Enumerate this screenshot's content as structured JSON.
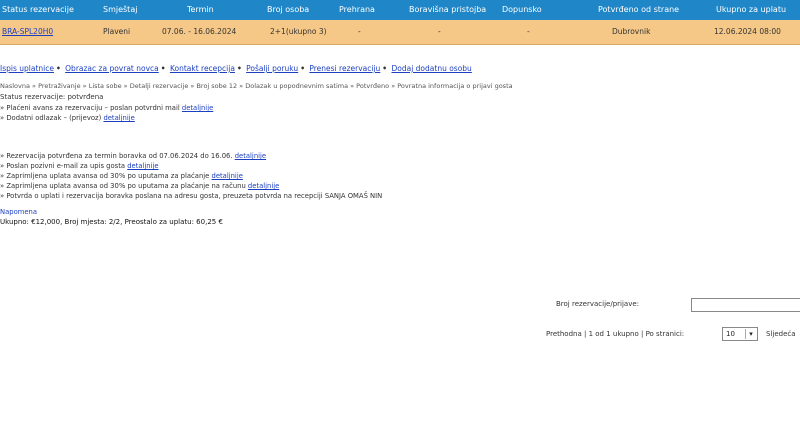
{
  "header": {
    "columns": [
      "Status rezervacije",
      "Smještaj",
      "Termin",
      "Broj osoba",
      "Prehrana",
      "Boravišna pristojba",
      "Dopunsko",
      "Potvrđeno od strane",
      "Ukupno za uplatu"
    ]
  },
  "booking_row": {
    "code": "BRA-SPL20H0",
    "accommodation": "Plaveni",
    "period": "07.06. - 16.06.2024",
    "persons": "2+1(ukupno 3)",
    "meals": "-",
    "tax": "-",
    "extras": "-",
    "confirmed_by": "Dubrovnik",
    "total": "12.06.2024 08:00"
  },
  "links": [
    "Ispis uplatnice",
    "Obrazac za povrat novca",
    "Kontakt recepcija",
    "Pošalji poruku",
    "Prenesi rezervaciju",
    "Dodaj dodatnu osobu"
  ],
  "breadcrumb": "Naslovna » Pretraživanje » Lista sobe » Detalji rezervacije » Broj sobe 12 » Dolazak u popodnevnim satima » Potvrđeno » Povratna informacija o prijavi gosta",
  "status_line": "Status rezervacije: potvrđena",
  "lines_top": [
    {
      "text": "Plaćeni avans za rezervaciju – poslan potvrdni mail",
      "link": "detaljnije"
    },
    {
      "text": "Dodatni odlazak – (prijevoz)",
      "link": "detaljnije"
    }
  ],
  "lines_bottom": [
    {
      "text": "Rezervacija potvrđena za termin boravka od 07.06.2024 do 16.06.",
      "link": "detaljnije"
    },
    {
      "text": "Poslan pozivni e-mail za upis gosta",
      "link": "detaljnije"
    },
    {
      "text": "Zaprimljena uplata avansa od 30% po uputama za plaćanje",
      "link": "detaljnije"
    },
    {
      "text": "Zaprimljena uplata avansa od 30% po uputama za plaćanje na računu",
      "link": "detaljnije"
    },
    {
      "text": "Potvrda o uplati i rezervacija boravka poslana na adresu gosta, preuzeta potvrda na recepciji SANJA OMAŠ NIN",
      "link": ""
    }
  ],
  "note_label": "Napomena",
  "totals_line": "Ukupno: €12,000, Broj mjesta: 2/2, Preostalo za uplatu: 60,25 €",
  "search": {
    "label": "Broj rezervacije/prijave:",
    "value": ""
  },
  "pager": {
    "prev": "Prethodna",
    "pages": "1 od 1 ukupno",
    "per_page_label": "Po stranici:",
    "per_page_value": "10",
    "next": "Sljedeća"
  }
}
